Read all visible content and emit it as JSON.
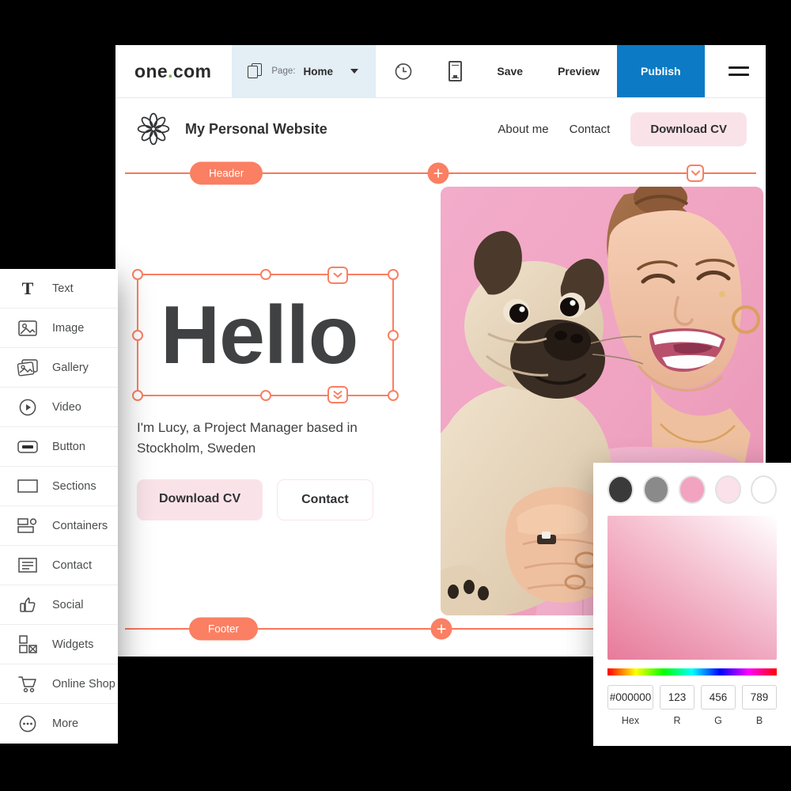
{
  "toolbar": {
    "logo": "one.com",
    "logo_name": "one",
    "logo_dot": ".",
    "logo_suffix": "com",
    "page_label": "Page:",
    "page_value": "Home",
    "pages_icon": "pages-icon",
    "caret_icon": "chevron-down-icon",
    "history_icon": "history-undo-icon",
    "mobile_icon": "mobile-preview-icon",
    "save_label": "Save",
    "preview_label": "Preview",
    "publish_label": "Publish",
    "menu_icon": "hamburger-menu-icon",
    "publish_color": "#0c7ac4",
    "page_select_bg": "#e3eef5"
  },
  "site_header": {
    "logo_icon": "flower-logo-icon",
    "title": "My Personal Website",
    "nav": [
      {
        "label": "About me"
      },
      {
        "label": "Contact"
      }
    ],
    "cta_label": "Download CV"
  },
  "sections": {
    "header_pill": "Header",
    "footer_pill": "Footer",
    "plus_icon": "add-section-icon",
    "chevron_icon": "chevron-down-icon",
    "accent_color": "#fa7f63"
  },
  "hero": {
    "headline": "Hello",
    "tagline": "I'm Lucy, a Project Manager based in Stockholm, Sweden",
    "btn_primary": "Download CV",
    "btn_secondary": "Contact",
    "photo_alt": "woman-with-pug-photo",
    "selection_handles": 8,
    "pink_bg": "#f0a8c0"
  },
  "widget_panel": {
    "items": [
      {
        "label": "Text",
        "icon": "text-icon"
      },
      {
        "label": "Image",
        "icon": "image-icon"
      },
      {
        "label": "Gallery",
        "icon": "gallery-icon"
      },
      {
        "label": "Video",
        "icon": "video-icon"
      },
      {
        "label": "Button",
        "icon": "button-icon"
      },
      {
        "label": "Sections",
        "icon": "sections-icon"
      },
      {
        "label": "Containers",
        "icon": "containers-icon"
      },
      {
        "label": "Contact",
        "icon": "contact-form-icon"
      },
      {
        "label": "Social",
        "icon": "thumbs-up-icon"
      },
      {
        "label": "Widgets",
        "icon": "widgets-icon"
      },
      {
        "label": "Online Shop",
        "icon": "shopping-cart-icon"
      },
      {
        "label": "More",
        "icon": "more-ellipsis-icon"
      }
    ]
  },
  "color_picker": {
    "swatches": [
      "#3a3a3a",
      "#8a8a8a",
      "#f2a3c0",
      "#fbe1ea",
      "#ffffff"
    ],
    "hex_value": "#000000",
    "r_value": "123",
    "g_value": "456",
    "b_value": "789",
    "hex_label": "Hex",
    "r_label": "R",
    "g_label": "G",
    "b_label": "B"
  }
}
